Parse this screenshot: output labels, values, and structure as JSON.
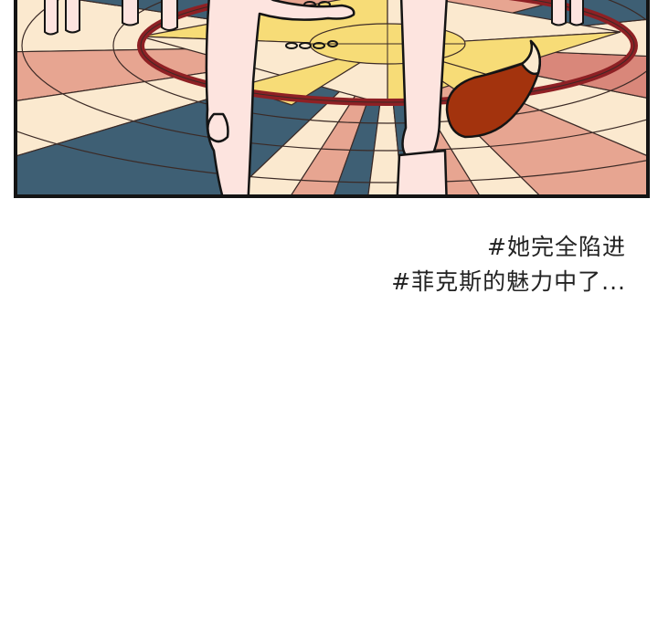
{
  "caption": {
    "line1": "#她完全陷进",
    "line2": "#菲克斯的魅力中了..."
  },
  "panel_colors": {
    "floor_blue": "#3e5f74",
    "floor_cream": "#fbe9cf",
    "floor_pink": "#e7a591",
    "floor_salmon": "#d9877a",
    "floor_yellow": "#f7dc77",
    "floor_light_blue": "#b9c9d2",
    "ring_red": "#8e2024",
    "skin": "#fde4df",
    "fox_tail": "#a3330d",
    "outline": "#141414"
  },
  "icons": {
    "fox_tail": "fox-tail-icon"
  }
}
